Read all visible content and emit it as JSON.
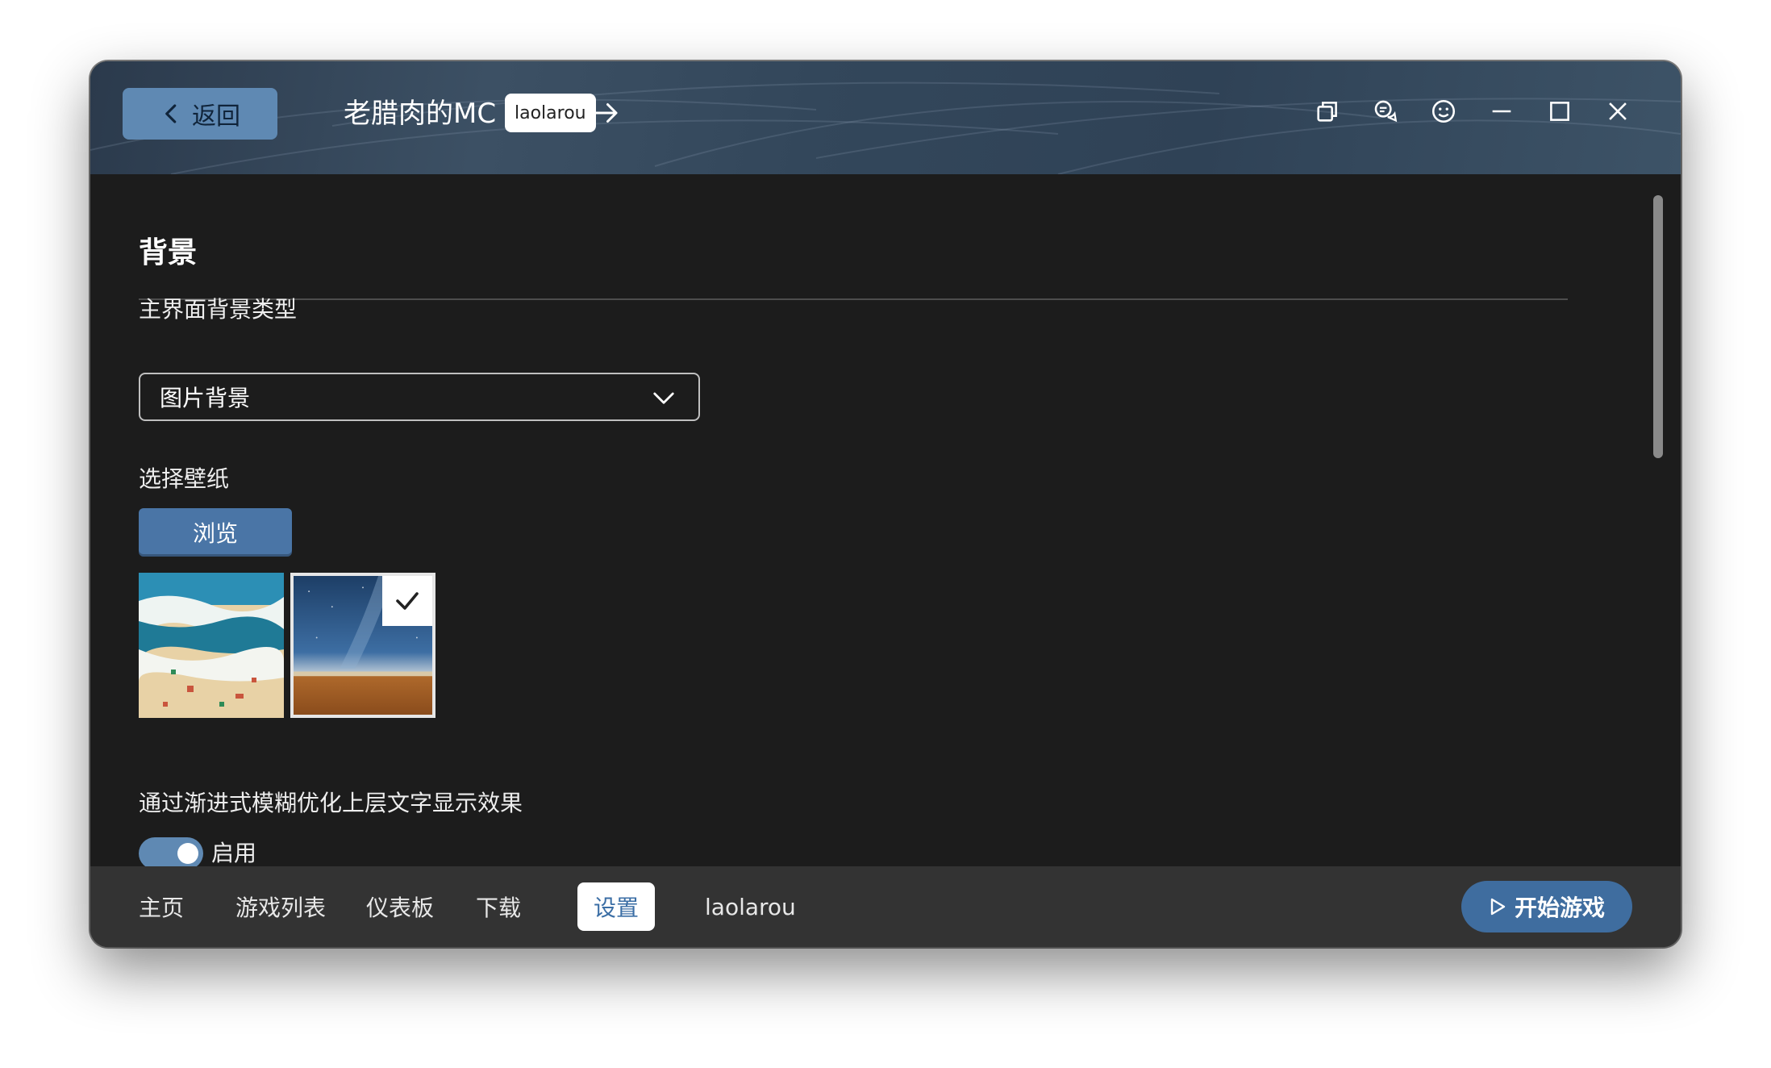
{
  "header": {
    "back_label": "返回",
    "app_title": "老腊肉的MC",
    "user_chip": "laolarou",
    "controls": [
      "copy-icon",
      "feedback-icon",
      "emoji-icon",
      "minimize-icon",
      "maximize-icon",
      "close-icon"
    ]
  },
  "main": {
    "section_title": "背景",
    "bg_type_label": "主界面背景类型",
    "bg_type_value": "图片背景",
    "wallpaper_label": "选择壁纸",
    "browse_label": "浏览",
    "wallpapers": [
      {
        "name": "wallpaper-beach",
        "selected": false
      },
      {
        "name": "wallpaper-starry-desert",
        "selected": true
      }
    ],
    "blur_label": "通过渐进式模糊优化上层文字显示效果",
    "toggle_label": "启用",
    "toggle_on": true
  },
  "nav": {
    "items": [
      "主页",
      "游戏列表",
      "仪表板",
      "下载",
      "设置",
      "laolarou"
    ],
    "active_index": 4,
    "start_label": "开始游戏"
  },
  "colors": {
    "accent": "#5f89b3",
    "start_button": "#3f6d9f",
    "content_bg": "#1c1c1c",
    "nav_bg": "#333333"
  }
}
